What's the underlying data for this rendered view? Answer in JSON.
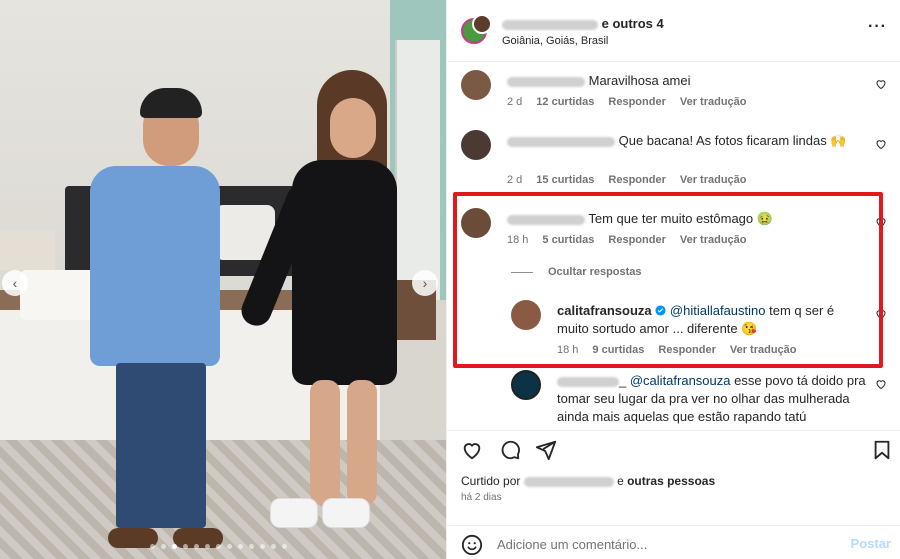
{
  "post": {
    "header": {
      "co_authors": "e outros 4",
      "location": "Goiânia, Goiás, Brasil"
    },
    "comments": [
      {
        "text": "Maravilhosa amei",
        "age": "2 d",
        "likes": "12 curtidas",
        "reply": "Responder",
        "translate": "Ver tradução"
      },
      {
        "text": "Que bacana! As fotos ficaram lindas 🙌",
        "age": "2 d",
        "likes": "15 curtidas",
        "reply": "Responder",
        "translate": "Ver tradução"
      },
      {
        "text": "Tem que ter muito estômago 🤢",
        "age": "18 h",
        "likes": "5 curtidas",
        "reply": "Responder",
        "translate": "Ver tradução"
      }
    ],
    "hide_replies": "Ocultar respostas",
    "reply": {
      "username": "calitafransouza",
      "mention": "@hitiallafaustino",
      "text": " tem q ser é muito sortudo amor ... diferente 😘",
      "age": "18 h",
      "likes": "9 curtidas",
      "reply": "Responder",
      "translate": "Ver tradução"
    },
    "truncated_comment": {
      "handle_suffix": "_",
      "mention": "@calitafransouza",
      "text": " esse povo tá doido pra tomar seu lugar da pra ver no olhar das mulherada ainda mais aquelas que estão rapando tatú"
    },
    "liked_by": {
      "prefix": "Curtido por",
      "and": "e",
      "others": "outras pessoas"
    },
    "time_ago": "há 2 dias",
    "add_comment_placeholder": "Adicione um comentário...",
    "post_label": "Postar"
  },
  "icons": {
    "more": "more-horizontal-icon",
    "heart": "heart-icon",
    "comment": "comment-icon",
    "share": "share-icon",
    "save": "bookmark-icon",
    "emoji": "emoji-icon",
    "verified": "verified-badge-icon",
    "prev": "chevron-left-icon",
    "next": "chevron-right-icon"
  },
  "colors": {
    "highlight": "#e0191e",
    "verified": "#0095f6",
    "post_button": "#b3dbff"
  }
}
